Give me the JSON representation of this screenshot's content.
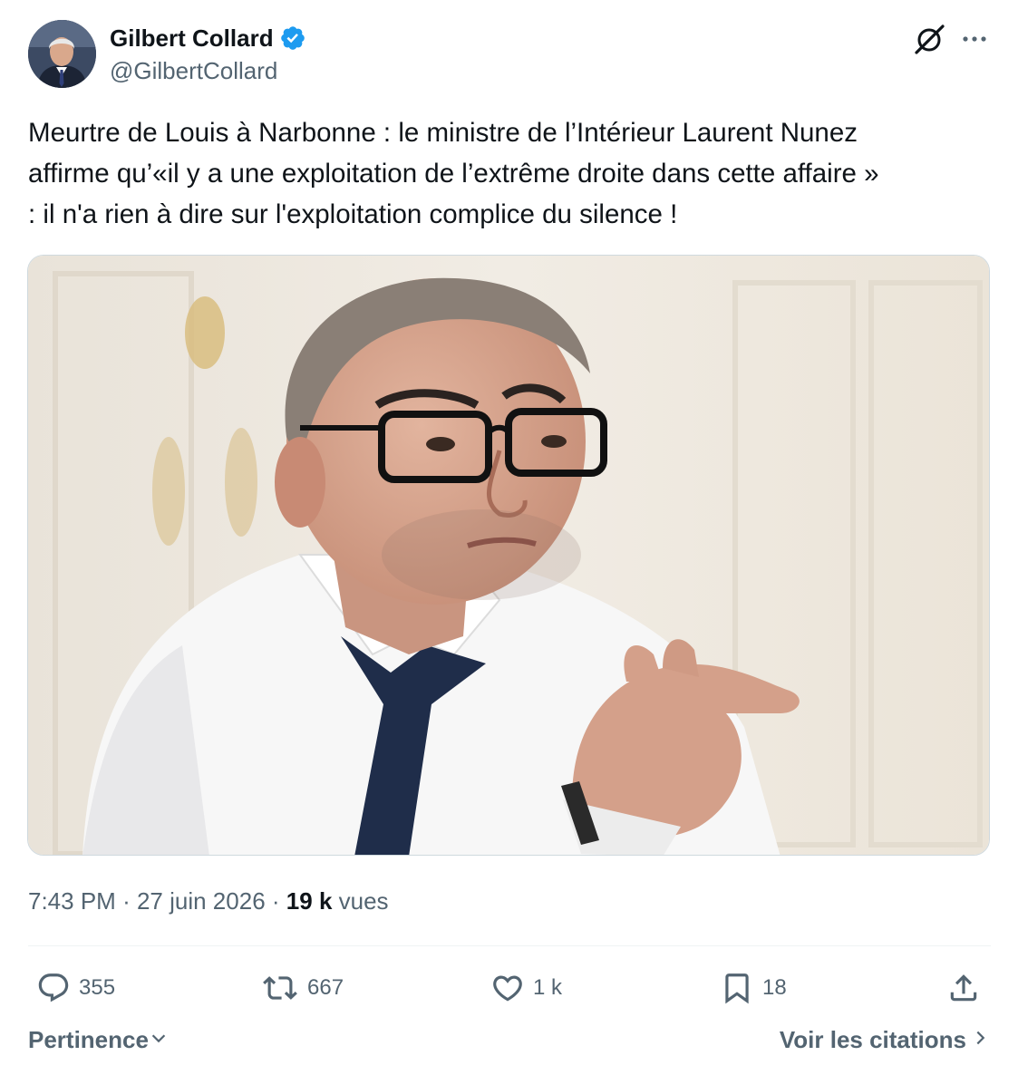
{
  "author": {
    "display_name": "Gilbert Collard",
    "handle": "@GilbertCollard",
    "verified": true
  },
  "header_icons": {
    "grok": "grok-icon",
    "more": "more-icon"
  },
  "tweet": {
    "text": "Meurtre de Louis à Narbonne : le ministre de l’Intérieur Laurent Nunez\naffirme qu’«il y a une exploitation de l’extrême droite dans cette affaire »\n: il n'a rien à dire sur l'exploitation complice du silence !"
  },
  "meta": {
    "time": "7:43 PM",
    "separator": "·",
    "date": "27 juin 2026",
    "views_count": "19 k",
    "views_label": "vues"
  },
  "actions": {
    "replies": "355",
    "reposts": "667",
    "likes": "1 k",
    "bookmarks": "18"
  },
  "footer": {
    "sort_label": "Pertinence",
    "quotes_label": "Voir les citations"
  },
  "colors": {
    "text": "#0f1419",
    "secondary": "#536471",
    "verified": "#1d9bf0",
    "divider": "#eff3f4"
  }
}
